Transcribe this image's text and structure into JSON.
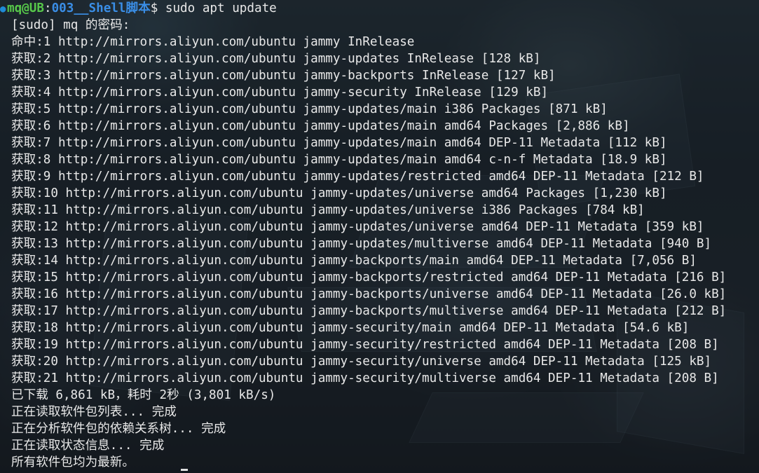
{
  "prompt": {
    "user_host": "mq@UB",
    "separator": ":",
    "path": "003__Shell脚本",
    "symbol": "$",
    "command": " sudo apt update"
  },
  "output_lines": [
    "[sudo] mq 的密码:",
    "命中:1 http://mirrors.aliyun.com/ubuntu jammy InRelease",
    "获取:2 http://mirrors.aliyun.com/ubuntu jammy-updates InRelease [128 kB]",
    "获取:3 http://mirrors.aliyun.com/ubuntu jammy-backports InRelease [127 kB]",
    "获取:4 http://mirrors.aliyun.com/ubuntu jammy-security InRelease [129 kB]",
    "获取:5 http://mirrors.aliyun.com/ubuntu jammy-updates/main i386 Packages [871 kB]",
    "获取:6 http://mirrors.aliyun.com/ubuntu jammy-updates/main amd64 Packages [2,886 kB]",
    "获取:7 http://mirrors.aliyun.com/ubuntu jammy-updates/main amd64 DEP-11 Metadata [112 kB]",
    "获取:8 http://mirrors.aliyun.com/ubuntu jammy-updates/main amd64 c-n-f Metadata [18.9 kB]",
    "获取:9 http://mirrors.aliyun.com/ubuntu jammy-updates/restricted amd64 DEP-11 Metadata [212 B]",
    "获取:10 http://mirrors.aliyun.com/ubuntu jammy-updates/universe amd64 Packages [1,230 kB]",
    "获取:11 http://mirrors.aliyun.com/ubuntu jammy-updates/universe i386 Packages [784 kB]",
    "获取:12 http://mirrors.aliyun.com/ubuntu jammy-updates/universe amd64 DEP-11 Metadata [359 kB]",
    "获取:13 http://mirrors.aliyun.com/ubuntu jammy-updates/multiverse amd64 DEP-11 Metadata [940 B]",
    "获取:14 http://mirrors.aliyun.com/ubuntu jammy-backports/main amd64 DEP-11 Metadata [7,056 B]",
    "获取:15 http://mirrors.aliyun.com/ubuntu jammy-backports/restricted amd64 DEP-11 Metadata [216 B]",
    "获取:16 http://mirrors.aliyun.com/ubuntu jammy-backports/universe amd64 DEP-11 Metadata [26.0 kB]",
    "获取:17 http://mirrors.aliyun.com/ubuntu jammy-backports/multiverse amd64 DEP-11 Metadata [212 B]",
    "获取:18 http://mirrors.aliyun.com/ubuntu jammy-security/main amd64 DEP-11 Metadata [54.6 kB]",
    "获取:19 http://mirrors.aliyun.com/ubuntu jammy-security/restricted amd64 DEP-11 Metadata [208 B]",
    "获取:20 http://mirrors.aliyun.com/ubuntu jammy-security/universe amd64 DEP-11 Metadata [125 kB]",
    "获取:21 http://mirrors.aliyun.com/ubuntu jammy-security/multiverse amd64 DEP-11 Metadata [208 B]",
    "已下载 6,861 kB，耗时 2秒 (3,801 kB/s)",
    "正在读取软件包列表... 完成",
    "正在分析软件包的依赖关系树... 完成",
    "正在读取状态信息... 完成",
    "所有软件包均为最新。"
  ],
  "colors": {
    "user_host": "#57c84a",
    "path": "#3a8ee6",
    "text": "#e8e8e8",
    "prompt_dot": "#1f8ad6"
  },
  "icons": {
    "prompt_marker": "prompt-dot-icon"
  }
}
